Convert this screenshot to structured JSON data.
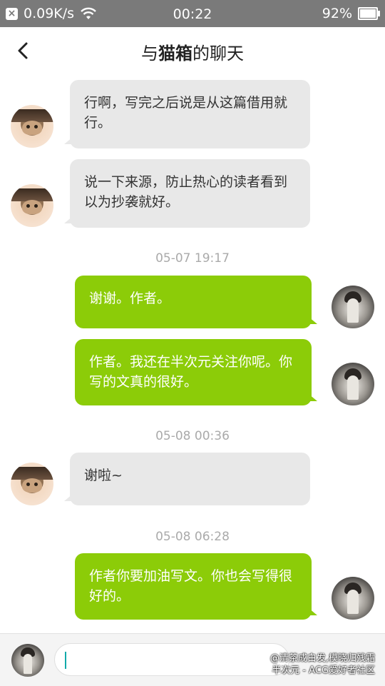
{
  "status_bar": {
    "net_speed": "0.09K/s",
    "time": "00:22",
    "battery_percent": "92%",
    "battery_level": 0.92,
    "icons": [
      "close-notification-icon",
      "wifi-icon",
      "battery-icon"
    ]
  },
  "header": {
    "title_prefix": "与",
    "title_name": "猫箱",
    "title_suffix": "的聊天",
    "back_icon": "chevron-left-icon"
  },
  "messages": [
    {
      "side": "in",
      "text": "行啊，写完之后说是从这篇借用就行。"
    },
    {
      "side": "in",
      "text": "说一下来源，防止热心的读者看到以为抄袭就好。"
    },
    {
      "timestamp": "05-07 19:17"
    },
    {
      "side": "out",
      "text": "谢谢。作者。"
    },
    {
      "side": "out",
      "text": "作者。我还在半次元关注你呢。你写的文真的很好。"
    },
    {
      "timestamp": "05-08 00:36"
    },
    {
      "side": "in",
      "text": "谢啦~"
    },
    {
      "timestamp": "05-08 06:28"
    },
    {
      "side": "out",
      "text": "作者你要加油写文。你也会写得很好的。"
    }
  ],
  "input": {
    "value": "",
    "watermark_line1": "@清茶成白发,模晓归残霜",
    "watermark_line2": "半次元 - ACG爱好者社区"
  },
  "colors": {
    "status_bar": "#7a7a7a",
    "incoming_bubble": "#e8e8e8",
    "outgoing_bubble": "#8ccc08",
    "timestamp": "#aaaaaa"
  }
}
